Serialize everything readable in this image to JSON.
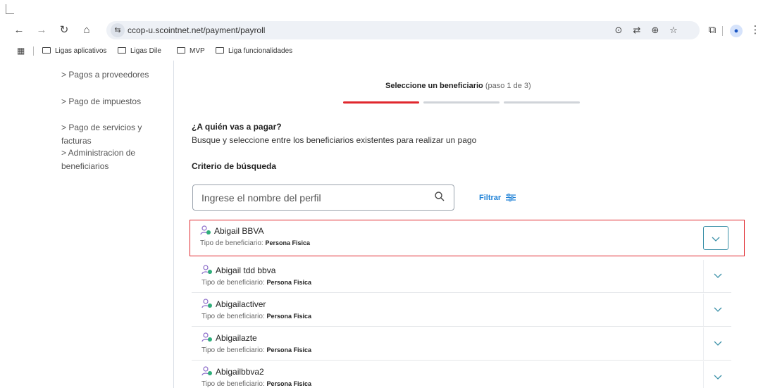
{
  "browser": {
    "url": "ccop-u.scointnet.net/payment/payroll",
    "bookmarks": [
      "Ligas aplicativos",
      "Ligas Dile",
      "MVP",
      "Liga funcionalidades"
    ]
  },
  "sidebar": {
    "items": [
      "> Pagos a proveedores",
      "> Pago de impuestos",
      "> Pago de servicios y facturas",
      "> Administracion de beneficiarios"
    ]
  },
  "stepper": {
    "title": "Seleccione un beneficiario",
    "subtitle": "(paso 1 de 3)",
    "current_step": 1,
    "total_steps": 3
  },
  "main": {
    "question": "¿A quién vas a pagar?",
    "description": "Busque y seleccione entre los beneficiarios existentes para realizar un pago",
    "criteria_label": "Criterio de búsqueda",
    "search_placeholder": "Ingrese el nombre del perfil",
    "filter_label": "Filtrar"
  },
  "beneficiaries": {
    "type_label": "Tipo de beneficiario:",
    "items": [
      {
        "name": "Abigail BBVA",
        "type": "Persona Fisica",
        "selected": true
      },
      {
        "name": "Abigail tdd bbva",
        "type": "Persona Fisica",
        "selected": false
      },
      {
        "name": "Abigailactiver",
        "type": "Persona Fisica",
        "selected": false
      },
      {
        "name": "Abigailazte",
        "type": "Persona Fisica",
        "selected": false
      },
      {
        "name": "Abigailbbva2",
        "type": "Persona Fisica",
        "selected": false
      }
    ]
  },
  "colors": {
    "accent_red": "#e0272d",
    "progress_inactive": "#d0d4d9",
    "link_blue": "#1a7fd6",
    "icon_purple": "#8a6bc8",
    "icon_green": "#2fae7a",
    "chevron_blue": "#3a90a8"
  }
}
